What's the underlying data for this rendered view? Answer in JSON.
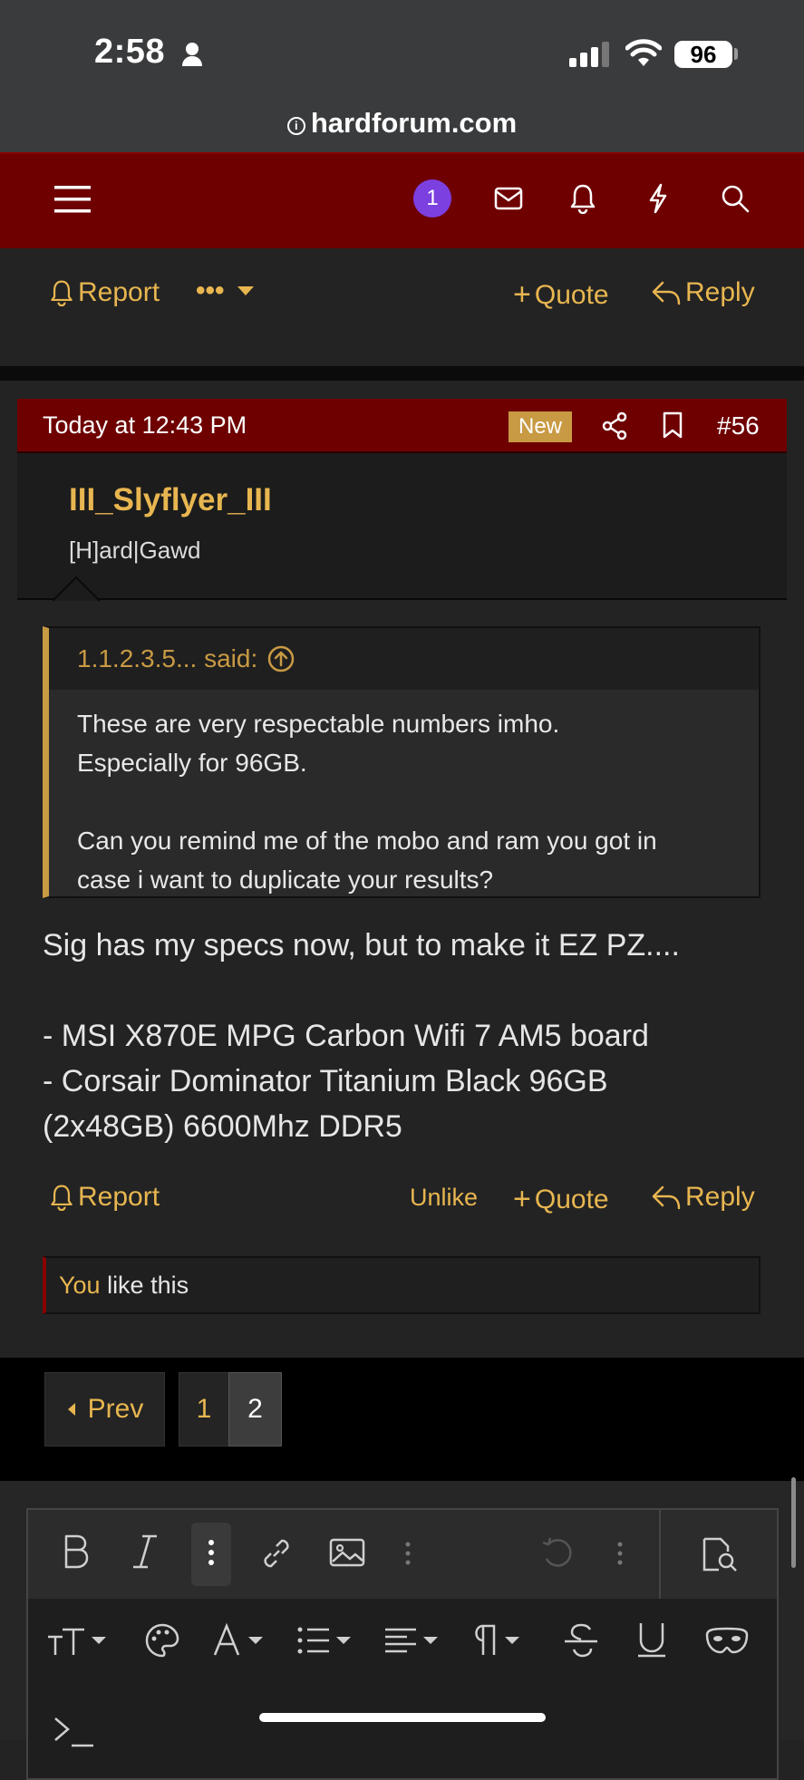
{
  "status": {
    "time": "2:58",
    "battery": "96"
  },
  "browser": {
    "url": "hardforum.com"
  },
  "nav": {
    "alert_count": "1"
  },
  "prev_post": {
    "report": "Report",
    "more": "•••",
    "quote": "Quote",
    "reply": "Reply"
  },
  "post": {
    "date": "Today at 12:43 PM",
    "new_badge": "New",
    "number": "#56",
    "username": "III_Slyflyer_III",
    "user_title": "[H]ard|Gawd",
    "quote": {
      "author": "1.1.2.3.5... said:",
      "line1": "These are very respectable numbers imho.",
      "line2": "Especially for 96GB.",
      "line3": "Can you remind me of the mobo and ram you got in",
      "line4": "case i want to duplicate your results?"
    },
    "body": {
      "line1": "Sig has my specs now, but to make it EZ PZ....",
      "line2": "- MSI X870E MPG Carbon Wifi 7 AM5 board",
      "line3": "- Corsair Dominator Titanium Black 96GB",
      "line4": "(2x48GB) 6600Mhz DDR5"
    },
    "actions": {
      "report": "Report",
      "unlike": "Unlike",
      "quote": "Quote",
      "reply": "Reply"
    },
    "reaction": {
      "you": "You",
      "text": " like this"
    }
  },
  "pagination": {
    "prev": "Prev",
    "pages": [
      "1",
      "2"
    ],
    "current": "2"
  },
  "colors": {
    "accent": "#e8b650",
    "header_red": "#6e0000",
    "badge_purple": "#7c3fe0"
  }
}
